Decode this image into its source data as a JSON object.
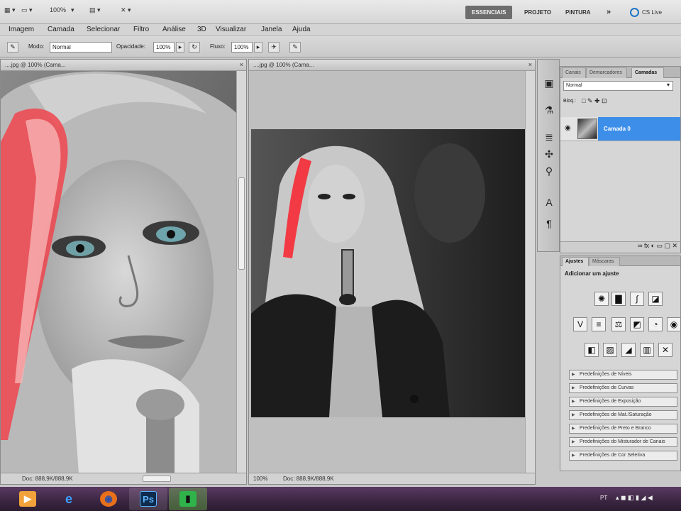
{
  "appbar": {
    "zoom": "100%",
    "workspaces": [
      "ESSENCIAIS",
      "PROJETO",
      "PINTURA"
    ],
    "more": "»",
    "cslive": "CS Live"
  },
  "menu": [
    "Imagem",
    "Camada",
    "Selecionar",
    "Filtro",
    "Análise",
    "3D",
    "Visualizar",
    "Janela",
    "Ajuda"
  ],
  "options": {
    "mode_label": "Modo:",
    "mode_value": "Normal",
    "opacity_label": "Opacidade:",
    "opacity_value": "100%",
    "flow_label": "Fluxo:",
    "flow_value": "100%"
  },
  "doc_left": {
    "tab": "....jpg @ 100% (Cama...",
    "status": "Doc: 888,9K/888,9K",
    "hair_highlight": "#f0444e"
  },
  "doc_right": {
    "tab": "....jpg @ 100% (Cama...",
    "zoom": "100%",
    "status": "Doc: 888,9K/888,9K",
    "hair_highlight": "#f23a44"
  },
  "layers_panel": {
    "tabs": [
      "Canais",
      "Demarcadores",
      "Camadas"
    ],
    "active_tab": "Camadas",
    "blend_mode": "Normal",
    "lock_label": "Bloq.:",
    "layer_name": "Camada 0",
    "selection_color": "#3d8ee8"
  },
  "adjust_panel": {
    "tabs": [
      "Ajustes",
      "Máscaras"
    ],
    "heading": "Adicionar um ajuste",
    "presets": [
      "Predefinições de Níveis",
      "Predefinições de Curvas",
      "Predefinições de Exposição",
      "Predefinições de Mat./Saturação",
      "Predefinições de Preto e Branco",
      "Predefinições do Misturador de Canais",
      "Predefinições de Cor Seletiva"
    ]
  },
  "taskbar": {
    "apps": [
      "media-player",
      "internet-explorer",
      "firefox",
      "photoshop",
      "camtasia"
    ],
    "lang": "PT"
  }
}
